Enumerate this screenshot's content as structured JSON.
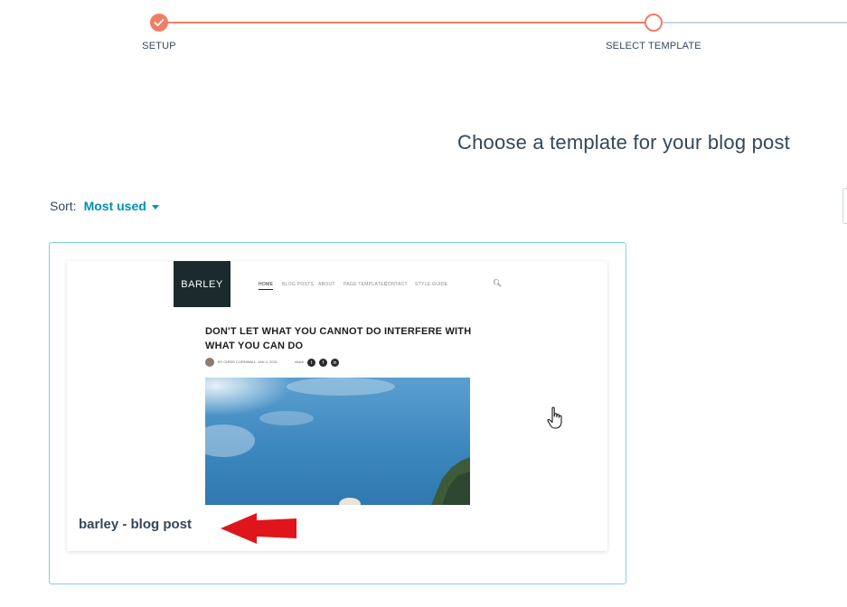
{
  "stepper": {
    "steps": [
      {
        "label": "SETUP",
        "state": "complete"
      },
      {
        "label": "SELECT TEMPLATE",
        "state": "current"
      }
    ],
    "colors": {
      "active": "#f07e64",
      "inactive": "#cbd6e2"
    }
  },
  "heading": "Choose a template for your blog post",
  "sort": {
    "label": "Sort:",
    "value": "Most used"
  },
  "template_card": {
    "name": "barley - blog post",
    "preview": {
      "logo": "BARLEY",
      "nav_items": [
        "HOME",
        "BLOG POSTS",
        "ABOUT",
        "PAGE TEMPLATES",
        "CONTACT",
        "STYLE GUIDE"
      ],
      "post_title": "DON'T LET WHAT YOU CANNOT DO INTERFERE WITH WHAT YOU CAN DO",
      "author": "BY CHRIS CORNWALL",
      "date": "JAN 4, 2021",
      "share_label": "share",
      "share_icons": [
        "twitter-icon",
        "facebook-icon",
        "linkedin-icon"
      ]
    }
  },
  "accent_color": "#0091ae"
}
